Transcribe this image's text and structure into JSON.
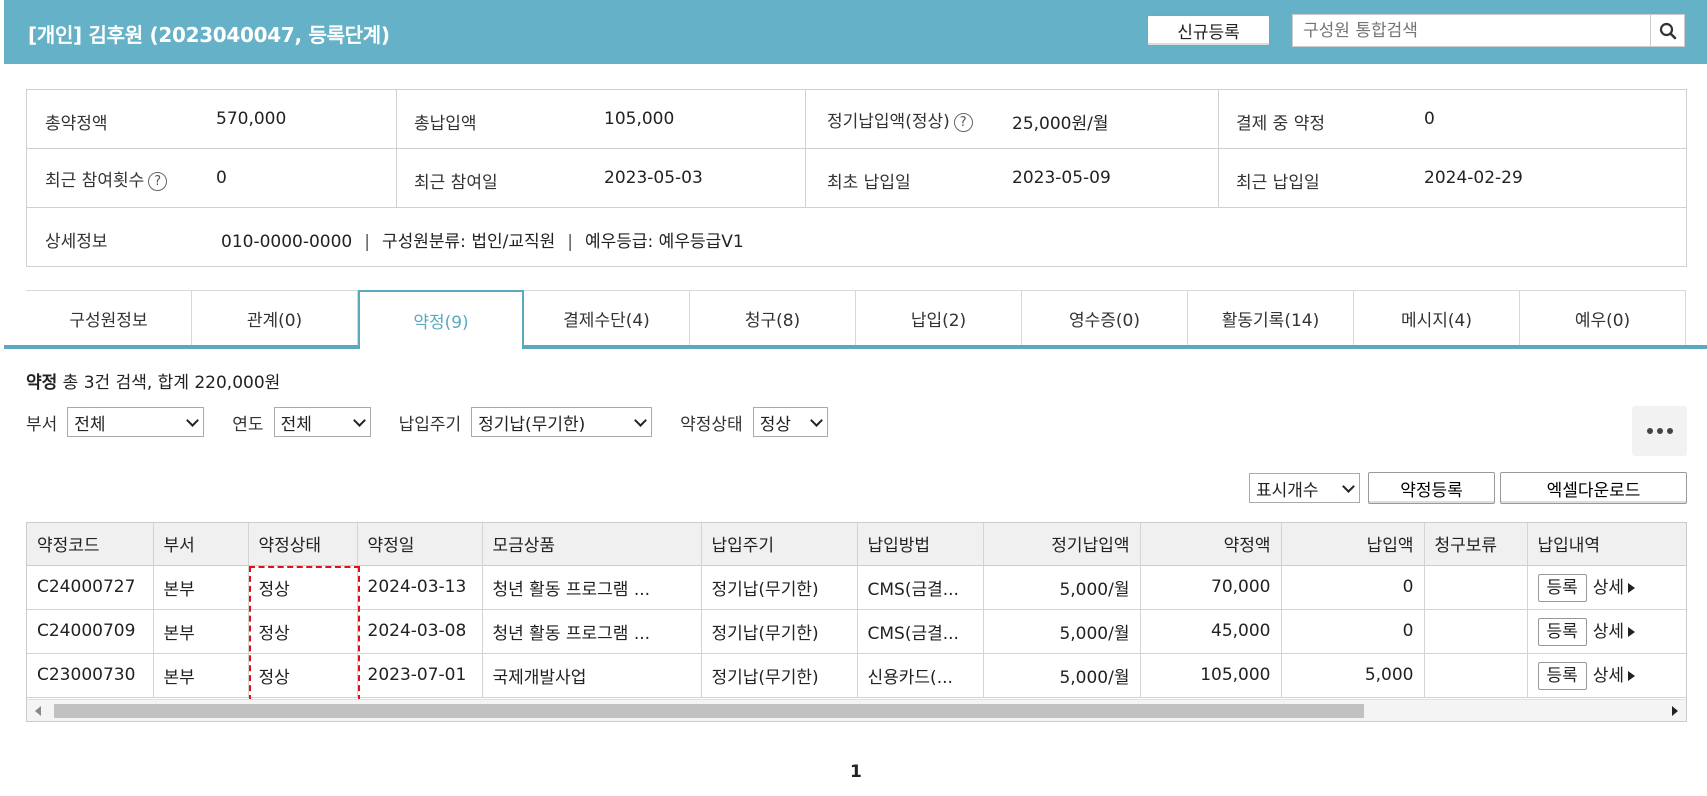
{
  "header": {
    "title": "[개인] 김후원 (2023040047, 등록단계)",
    "new_button": "신규등록",
    "search_placeholder": "구성원 통합검색",
    "search_icon": "search-icon",
    "bg_color": "#65b1c7"
  },
  "summary": {
    "row1": [
      {
        "label": "총약정액",
        "value": "570,000"
      },
      {
        "label": "총납입액",
        "value": "105,000"
      },
      {
        "label": "정기납입액(정상)",
        "value": "25,000원/월",
        "help": "?"
      },
      {
        "label": "결제 중 약정",
        "value": "0"
      }
    ],
    "row2": [
      {
        "label": "최근 참여횟수",
        "value": "0",
        "help": "?"
      },
      {
        "label": "최근 참여일",
        "value": "2023-05-03"
      },
      {
        "label": "최초 납입일",
        "value": "2023-05-09"
      },
      {
        "label": "최근 납입일",
        "value": "2024-02-29"
      }
    ],
    "detail": {
      "label": "상세정보",
      "phone": "010-0000-0000",
      "category": "구성원분류: 법인/교직원",
      "grade": "예우등급: 예우등급V1",
      "separator": "|"
    }
  },
  "tabs": [
    {
      "label": "구성원정보"
    },
    {
      "label": "관계(0)"
    },
    {
      "label": "약정(9)",
      "active": true
    },
    {
      "label": "결제수단(4)"
    },
    {
      "label": "청구(8)"
    },
    {
      "label": "납입(2)"
    },
    {
      "label": "영수증(0)"
    },
    {
      "label": "활동기록(14)"
    },
    {
      "label": "메시지(4)"
    },
    {
      "label": "예우(0)"
    }
  ],
  "section": {
    "title": "약정",
    "summary": " 총 3건 검색, 합계 220,000원",
    "filters": [
      {
        "label": "부서",
        "value": "전체"
      },
      {
        "label": "연도",
        "value": "전체"
      },
      {
        "label": "납입주기",
        "value": "정기납(무기한)"
      },
      {
        "label": "약정상태",
        "value": "정상"
      }
    ],
    "display_count": "표시개수",
    "register_button": "약정등록",
    "excel_button": "엑셀다운로드"
  },
  "table": {
    "columns": [
      "약정코드",
      "부서",
      "약정상태",
      "약정일",
      "모금상품",
      "납입주기",
      "납입방법",
      "정기납입액",
      "약정액",
      "납입액",
      "청구보류",
      "납입내역"
    ],
    "rows": [
      [
        "C24000727",
        "본부",
        "정상",
        "2024-03-13",
        "청년 활동 프로그램 ...",
        "정기납(무기한)",
        "CMS(금결...",
        "5,000/월",
        "70,000",
        "0",
        "",
        ""
      ],
      [
        "C24000709",
        "본부",
        "정상",
        "2024-03-08",
        "청년 활동 프로그램 ...",
        "정기납(무기한)",
        "CMS(금결...",
        "5,000/월",
        "45,000",
        "0",
        "",
        ""
      ],
      [
        "C23000730",
        "본부",
        "정상",
        "2023-07-01",
        "국제개발사업",
        "정기납(무기한)",
        "신용카드(...",
        "5,000/월",
        "105,000",
        "5,000",
        "",
        ""
      ]
    ],
    "row_button": "등록",
    "row_link": "상세"
  },
  "pagination": {
    "current": "1"
  },
  "colors": {
    "accent": "#5aa9bf",
    "highlight": "#e0111b"
  }
}
